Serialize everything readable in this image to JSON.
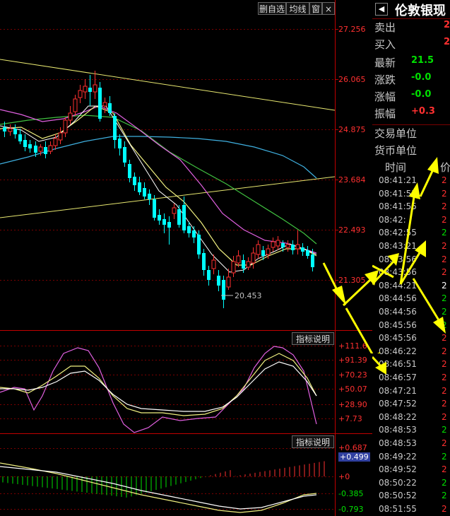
{
  "toolbar": {
    "delete_watch": "删自选",
    "ma_line": "均线",
    "window": "窗"
  },
  "main_chart": {
    "y_labels": [
      "27.256",
      "26.065",
      "24.875",
      "23.684",
      "22.493",
      "21.305"
    ],
    "low_annotation": "20.453"
  },
  "indicator1": {
    "button": "指标说明",
    "y_labels": [
      "+111.6",
      "+91.39",
      "+70.23",
      "+50.07",
      "+28.90",
      "+7.73"
    ]
  },
  "indicator2": {
    "button": "指标说明",
    "y_labels": [
      "+0.687",
      "+0.499",
      "+0",
      "-0.385",
      "-0.793"
    ]
  },
  "quote_panel": {
    "arrow": "◀",
    "name": "伦敦银现",
    "rows": [
      {
        "label": "卖出",
        "value": "2",
        "color": "#ff3030"
      },
      {
        "label": "买入",
        "value": "2",
        "color": "#ff3030"
      },
      {
        "label": "最新",
        "value": "21.5",
        "color": "#00e000"
      },
      {
        "label": "涨跌",
        "value": "-0.0",
        "color": "#00e000"
      },
      {
        "label": "涨幅",
        "value": "-0.0",
        "color": "#00e000"
      },
      {
        "label": "振幅",
        "value": "+0.3",
        "color": "#ff3030"
      }
    ],
    "unit_rows": [
      "交易单位",
      "货币单位"
    ],
    "tick_header_time": "时间",
    "tick_header_price": "价",
    "ticks": [
      {
        "time": "08:41:21",
        "price": "2",
        "color": "#ff3030"
      },
      {
        "time": "08:41:55",
        "price": "2",
        "color": "#ff3030"
      },
      {
        "time": "08:41:55",
        "price": "2",
        "color": "#ff3030"
      },
      {
        "time": "08:42:",
        "price": "2",
        "color": "#ff3030"
      },
      {
        "time": "08:42:55",
        "price": "2",
        "color": "#00e000"
      },
      {
        "time": "08:43:21",
        "price": "2",
        "color": "#ff3030"
      },
      {
        "time": "08:43:56",
        "price": "2",
        "color": "#ff3030"
      },
      {
        "time": "08:43:56",
        "price": "2",
        "color": "#ff3030"
      },
      {
        "time": "08:44:21",
        "price": "2",
        "color": "#ffffff"
      },
      {
        "time": "08:44:56",
        "price": "2",
        "color": "#00e000"
      },
      {
        "time": "08:44:56",
        "price": "2",
        "color": "#00e000"
      },
      {
        "time": "08:45:56",
        "price": "2",
        "color": "#00e000"
      },
      {
        "time": "08:45:56",
        "price": "2",
        "color": "#ff3030"
      },
      {
        "time": "08:46:22",
        "price": "2",
        "color": "#ff3030"
      },
      {
        "time": "08:46:51",
        "price": "2",
        "color": "#ff3030"
      },
      {
        "time": "08:46:57",
        "price": "2",
        "color": "#ff3030"
      },
      {
        "time": "08:47:21",
        "price": "2",
        "color": "#ff3030"
      },
      {
        "time": "08:47:52",
        "price": "2",
        "color": "#ff3030"
      },
      {
        "time": "08:48:22",
        "price": "2",
        "color": "#ff3030"
      },
      {
        "time": "08:48:53",
        "price": "2",
        "color": "#00e000"
      },
      {
        "time": "08:48:53",
        "price": "2",
        "color": "#ff3030"
      },
      {
        "time": "08:49:22",
        "price": "2",
        "color": "#00e000"
      },
      {
        "time": "08:49:52",
        "price": "2",
        "color": "#ff3030"
      },
      {
        "time": "08:50:22",
        "price": "2",
        "color": "#00e000"
      },
      {
        "time": "08:50:52",
        "price": "2",
        "color": "#00e000"
      },
      {
        "time": "08:51:55",
        "price": "2",
        "color": "#ff3030"
      }
    ]
  },
  "colors": {
    "up": "#ff3030",
    "down": "#00ffff",
    "flat": "#00e000",
    "grid": "#7a0000",
    "annotation_arrow": "#ffff00"
  }
}
